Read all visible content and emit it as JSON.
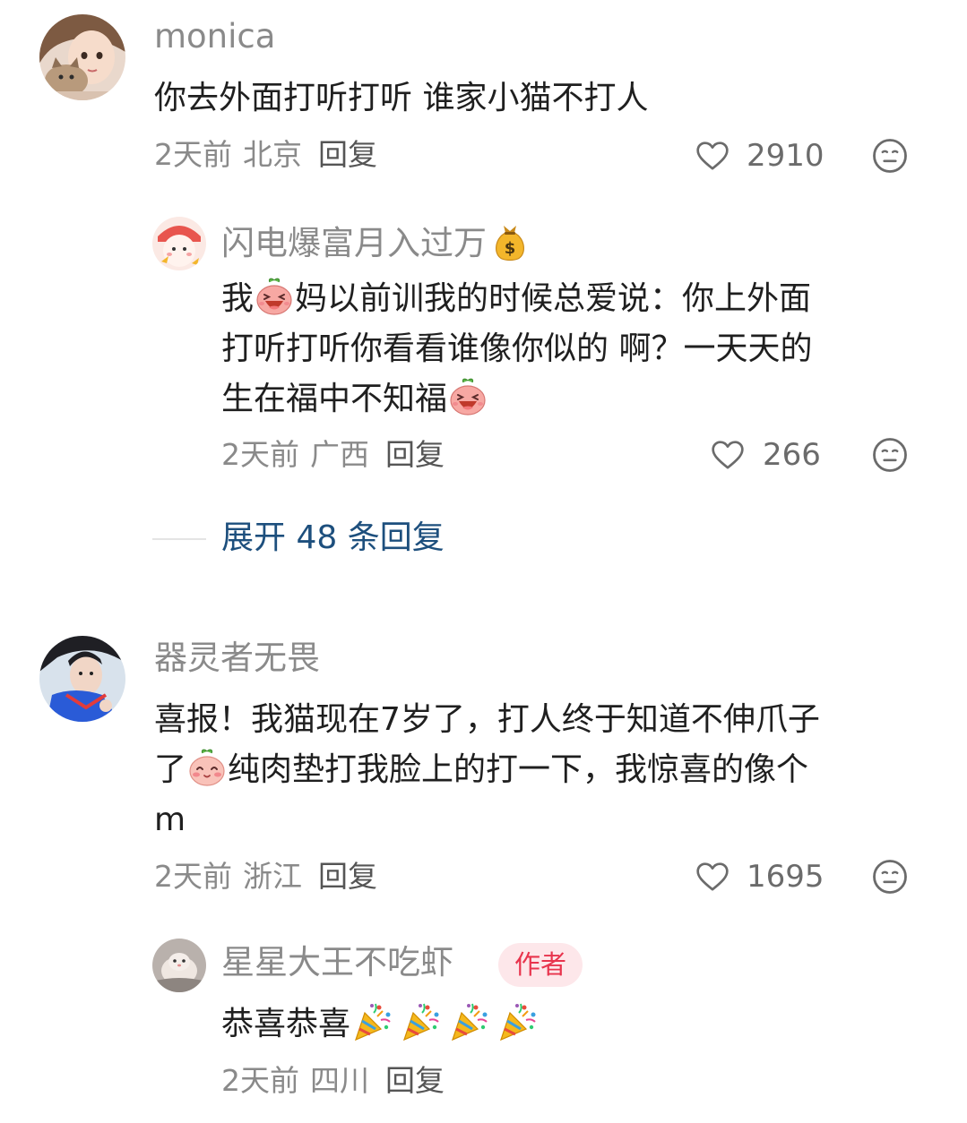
{
  "comments": [
    {
      "username": "monica",
      "text": "你去外面打听打听 谁家小猫不打人",
      "time": "2天前",
      "location": "北京",
      "reply_label": "回复",
      "likes": "2910"
    },
    {
      "username": "器灵者无畏",
      "text_line1": "喜报！我猫现在7岁了，打人终于知道不伸爪子",
      "text_line2a": "了",
      "text_line2b": "纯肉垫打我脸上的打一下，我惊喜的像个",
      "text_line3": "m",
      "time": "2天前",
      "location": "浙江",
      "reply_label": "回复",
      "likes": "1695"
    }
  ],
  "replies": [
    {
      "username": "闪电爆富月入过万",
      "l1a": "我",
      "l1b": "妈以前训我的时候总爱说：你上外面",
      "l2": "打听打听你看看谁像你似的 啊？一天天的",
      "l3": "生在福中不知福",
      "time": "2天前",
      "location": "广西",
      "reply_label": "回复",
      "likes": "266"
    },
    {
      "username": "星星大王不吃虾",
      "badge": "作者",
      "text": "恭喜恭喜",
      "time": "2天前",
      "location": "四川",
      "reply_label": "回复"
    }
  ],
  "expand_replies": "展开 48 条回复",
  "icons": {
    "like": "heart-outline-icon",
    "dislike": "neutral-face-icon",
    "money": "money-bag-icon",
    "laugh": "laughing-face-emoji",
    "shy": "shy-face-emoji",
    "celebrate": "party-popper-emoji"
  },
  "colors": {
    "username": "#8a8a8a",
    "text": "#1f1f1f",
    "expand": "#1d4f7d",
    "author_badge_bg": "#fde7ea",
    "author_badge_text": "#e8344d"
  }
}
